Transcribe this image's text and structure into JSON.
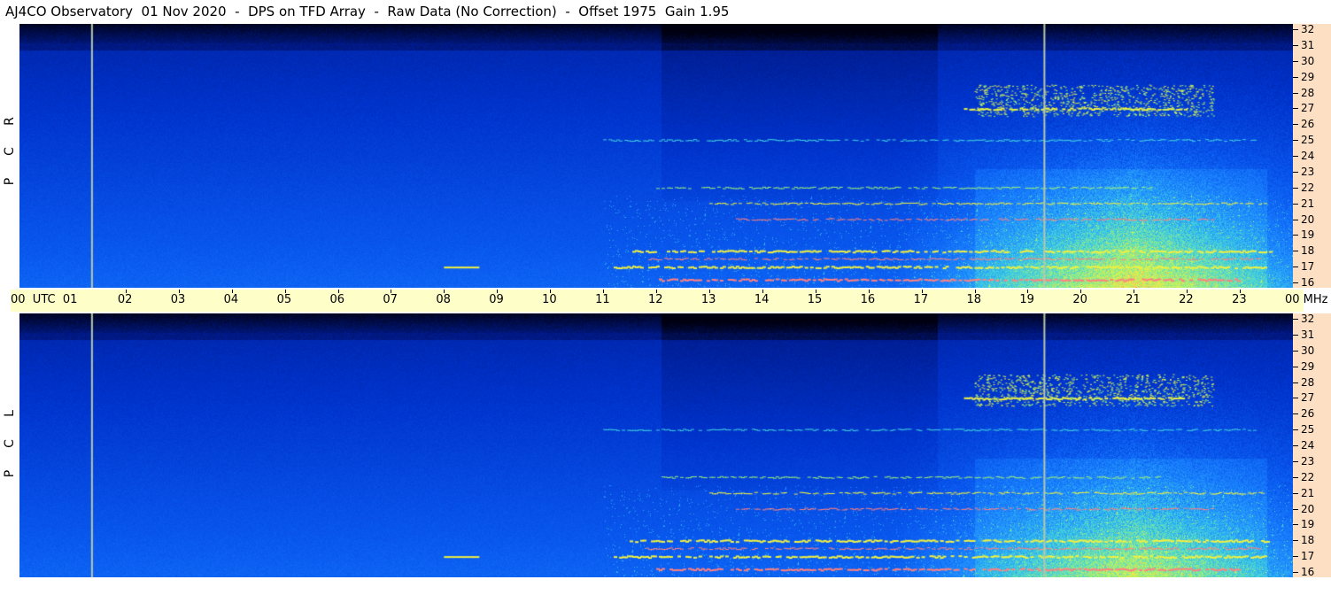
{
  "title": "AJ4CO Observatory  01 Nov 2020  -  DPS on TFD Array  -  Raw Data (No Correction)  -  Offset 1975  Gain 1.95",
  "panels": [
    {
      "id": "rcp",
      "side_label": [
        "R",
        "C",
        "P"
      ]
    },
    {
      "id": "lcp",
      "side_label": [
        "L",
        "C",
        "P"
      ]
    }
  ],
  "time_axis": {
    "start_label": "00  UTC  01",
    "hours": [
      "02",
      "03",
      "04",
      "05",
      "06",
      "07",
      "08",
      "09",
      "10",
      "11",
      "12",
      "13",
      "14",
      "15",
      "16",
      "17",
      "18",
      "19",
      "20",
      "21",
      "22",
      "23"
    ],
    "end_label": "00 MHz"
  },
  "chart_data": {
    "type": "heatmap",
    "title": "AJ4CO Observatory  01 Nov 2020  -  DPS on TFD Array  -  Raw Data (No Correction)  -  Offset 1975  Gain 1.95",
    "xlabel": "UTC",
    "ylabel": "MHz",
    "x_range_hours": [
      0,
      24
    ],
    "y_range_mhz": [
      16,
      32
    ],
    "y_ticks": [
      32,
      31,
      30,
      29,
      28,
      27,
      26,
      25,
      24,
      23,
      22,
      21,
      20,
      19,
      18,
      17,
      16
    ],
    "panels": [
      "RCP",
      "LCP"
    ],
    "colormap": [
      "#000010",
      "#001a8a",
      "#0033cc",
      "#0a5af0",
      "#1e8cff",
      "#3fd0e0",
      "#9cf07a",
      "#f0f040",
      "#ff8080"
    ],
    "vertical_markers_utc": [
      1.35,
      19.3
    ],
    "rfi_lines_mhz": [
      27.0,
      25.0,
      22.0,
      21.0,
      20.0,
      18.0,
      17.0,
      16.2
    ],
    "bright_region_utc": [
      18,
      23.5
    ],
    "dark_band_utc": [
      12.1,
      17.3
    ]
  }
}
